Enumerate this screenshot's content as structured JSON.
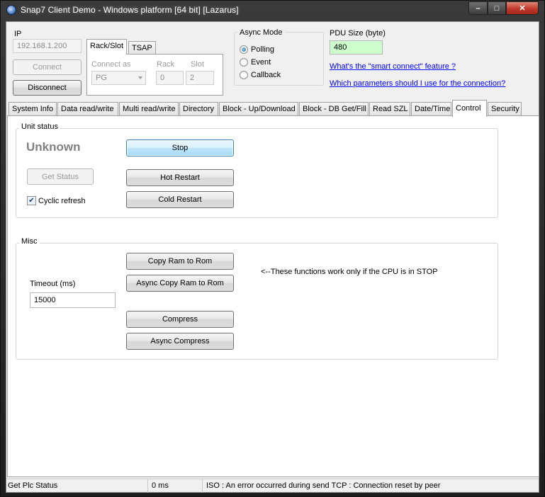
{
  "window": {
    "title": "Snap7 Client Demo - Windows platform [64 bit] [Lazarus]",
    "icons": {
      "app": "snap7-app-icon",
      "minimize": "minimize-icon",
      "maximize": "maximize-icon",
      "close": "close-icon"
    },
    "minimize_glyph": "–",
    "maximize_glyph": "□",
    "close_glyph": "✕"
  },
  "connection": {
    "ip_label": "IP",
    "ip_value": "192.168.1.200",
    "connect_label": "Connect",
    "disconnect_label": "Disconnect",
    "tabs": [
      "Rack/Slot",
      "TSAP"
    ],
    "connect_as_label": "Connect as",
    "connect_as_value": "PG",
    "rack_label": "Rack",
    "rack_value": "0",
    "slot_label": "Slot",
    "slot_value": "2"
  },
  "async_mode": {
    "title": "Async Mode",
    "options": [
      "Polling",
      "Event",
      "Callback"
    ],
    "selected": "Polling"
  },
  "pdu": {
    "label": "PDU Size (byte)",
    "value": "480",
    "value_bg_color": "#ccffcc",
    "link1": "What's the \"smart connect\" feature ?",
    "link2": "Which parameters should I use for the connection?"
  },
  "main_tabs": {
    "items": [
      "System Info",
      "Data read/write",
      "Multi read/write",
      "Directory",
      "Block - Up/Download",
      "Block - DB Get/Fill",
      "Read SZL",
      "Date/Time",
      "Control",
      "Security"
    ],
    "active": "Control"
  },
  "unit_status": {
    "title": "Unit status",
    "status_text": "Unknown",
    "get_status_label": "Get Status",
    "cyclic_refresh_label": "Cyclic refresh",
    "cyclic_refresh_checked": true,
    "check_glyph": "✔",
    "stop_label": "Stop",
    "hot_restart_label": "Hot Restart",
    "cold_restart_label": "Cold Restart"
  },
  "misc": {
    "title": "Misc",
    "copy_ram_label": "Copy Ram to Rom",
    "async_copy_ram_label": "Async Copy Ram to Rom",
    "note": "<--These functions work only if the CPU is in STOP",
    "timeout_label": "Timeout (ms)",
    "timeout_value": "15000",
    "compress_label": "Compress",
    "async_compress_label": "Async Compress"
  },
  "status_bar": {
    "message": "Get Plc Status",
    "time": "0 ms",
    "error": "ISO : An error occurred during send TCP : Connection reset by peer"
  }
}
